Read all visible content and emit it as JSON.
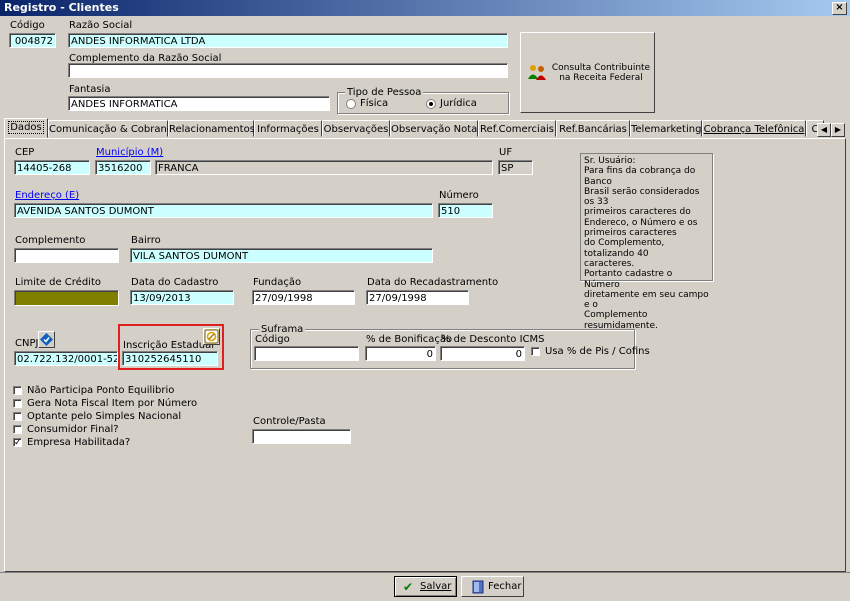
{
  "window": {
    "title": "Registro - Clientes",
    "close": "×"
  },
  "header": {
    "codigo_label": "Código",
    "codigo": "004872",
    "razao_label": "Razão Social",
    "razao": "ANDES INFORMATICA LTDA",
    "complemento_razao_label": "Complemento da Razão Social",
    "complemento_razao": "",
    "fantasia_label": "Fantasia",
    "fantasia": "ANDES INFORMATICA",
    "tipo_pessoa_label": "Tipo de Pessoa",
    "fisica": "Física",
    "juridica": "Jurídica",
    "tipo_pessoa_selected": "Jurídica",
    "consulta_label": "Consulta Contribuinte na Receita Federal"
  },
  "tabs": [
    "Dados",
    "Comunicação & Cobrança",
    "Relacionamentos",
    "Informações",
    "Observações",
    "Observação Nota",
    "Ref.Comerciais",
    "Ref.Bancárias",
    "Telemarketing",
    "Cobrança Telefônica",
    "C"
  ],
  "active_tab": "Dados",
  "dados": {
    "cep_label": "CEP",
    "cep": "14405-268",
    "municipio_label": "Município (M)",
    "municipio_codigo": "3516200",
    "municipio_nome": "FRANCA",
    "uf_label": "UF",
    "uf": "SP",
    "endereco_label": "Endereço (E)",
    "endereco": "AVENIDA SANTOS DUMONT",
    "numero_label": "Número",
    "numero": "510",
    "complemento_label": "Complemento",
    "complemento": "",
    "bairro_label": "Bairro",
    "bairro": "VILA SANTOS DUMONT",
    "limite_label": "Limite de Crédito",
    "cadastro_label": "Data do Cadastro",
    "cadastro": "13/09/2013",
    "fundacao_label": "Fundação",
    "fundacao": "27/09/1998",
    "recadastro_label": "Data do Recadastramento",
    "recadastro": "27/09/1998",
    "cnpj_label": "CNPJ",
    "cnpj": "02.722.132/0001-52",
    "ie_label": "Inscrição Estadual",
    "ie": "310252645110",
    "suframa_label": "Suframa",
    "codigo_label": "Código",
    "suframa_codigo": "",
    "bonificacao_label": "% de Bonificação",
    "bonificacao": "0",
    "desconto_label": "% de Desconto ICMS",
    "desconto": "0",
    "pis_label": "Usa % de Pis / Cofins",
    "controle_label": "Controle/Pasta",
    "controle": "",
    "note_lines": [
      "Sr. Usuário:",
      "Para fins da cobrança do Banco",
      "Brasil serão considerados os 33",
      "primeiros caracteres do",
      "Endereco, o Número e os",
      "primeiros caracteres",
      "do Complemento, totalizando 40",
      "caracteres.",
      "Portanto cadastre o Número",
      "diretamente em seu campo e o",
      "Complemento resumidamente."
    ],
    "checkboxes": [
      {
        "label": "Não Participa Ponto Equilibrio",
        "checked": false
      },
      {
        "label": "Gera Nota Fiscal Item por Número",
        "checked": false
      },
      {
        "label": "Optante pelo Simples Nacional",
        "checked": false
      },
      {
        "label": "Consumidor Final?",
        "checked": false
      },
      {
        "label": "Empresa Habilitada?",
        "checked": true
      }
    ]
  },
  "footer": {
    "salvar": "Salvar",
    "fechar": "Fechar"
  },
  "colors": {
    "title_start": "#0a246a",
    "field_cyan": "#ccffff",
    "limite": "#808000",
    "highlight": "#e02020"
  }
}
